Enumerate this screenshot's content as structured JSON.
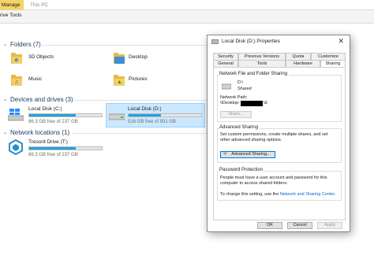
{
  "ribbon": {
    "tab_manage": "Manage",
    "tab_thispc": "This PC",
    "drive_tools": "rive Tools"
  },
  "folders": {
    "header": "Folders (7)",
    "items": [
      {
        "label": "3D Objects"
      },
      {
        "label": "Desktop"
      },
      {
        "label": "Music"
      },
      {
        "label": "Pictures"
      }
    ]
  },
  "devices": {
    "header": "Devices and drives (3)",
    "drives": [
      {
        "name": "Local Disk (C:)",
        "free": "86.3 GB free of 237 GB",
        "used_fraction": 0.64
      },
      {
        "name": "Local Disk (D:)",
        "free": "516 GB free of 931 GB",
        "used_fraction": 0.45
      }
    ]
  },
  "network": {
    "header": "Network locations (1)",
    "items": [
      {
        "name": "Tresorit Drive (T:)",
        "free": "86.3 GB free of 237 GB",
        "used_fraction": 0.64
      }
    ]
  },
  "dialog": {
    "title": "Local Disk (D:) Properties",
    "close": "✕",
    "tabs_row1": [
      "Security",
      "Previous Versions",
      "Quota",
      "Customize"
    ],
    "tabs_row2": [
      "General",
      "Tools",
      "Hardware",
      "Sharing"
    ],
    "nfs_section": "Network File and Folder Sharing",
    "share_name": "D:\\",
    "share_state": "Shared",
    "network_path_label": "Network Path:",
    "network_path_prefix": "\\\\Desktop-",
    "network_path_suffix": "\\d",
    "share_button": "Share...",
    "adv_section": "Advanced Sharing",
    "adv_desc": "Set custom permissions, create multiple shares, and set other advanced sharing options.",
    "adv_button": "Advanced Sharing...",
    "pw_section": "Password Protection",
    "pw_desc": "People must have a user account and password for this computer to access shared folders.",
    "pw_change_prefix": "To change this setting, use the ",
    "pw_change_link": "Network and Sharing Center",
    "pw_change_suffix": ".",
    "ok": "OK",
    "cancel": "Cancel",
    "apply": "Apply"
  },
  "colors": {
    "accent": "#26a0da",
    "selection": "#cce8ff",
    "manage_tab": "#f5d46a",
    "link": "#0066cc"
  }
}
